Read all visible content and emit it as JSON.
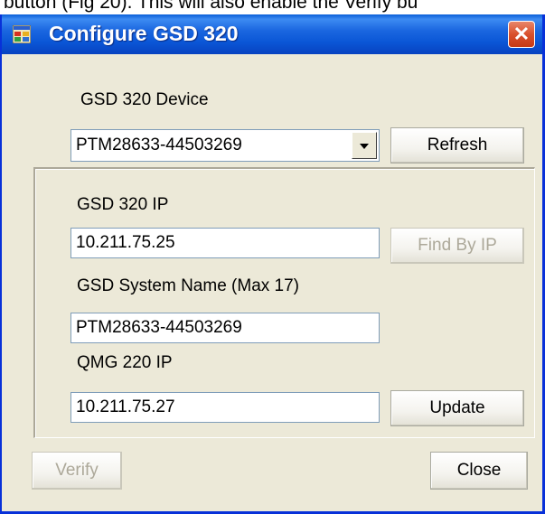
{
  "background_doc": {
    "text": "button (Fig 20). This will also enable the Verify bu"
  },
  "window": {
    "title": "Configure GSD 320",
    "close_glyph": "✕"
  },
  "device": {
    "label": "GSD 320 Device",
    "selected": "PTM28633-44503269",
    "refresh_label": "Refresh"
  },
  "ip": {
    "label": "GSD 320 IP",
    "value": "10.211.75.25",
    "find_label": "Find By IP"
  },
  "system_name": {
    "label": "GSD System Name  (Max 17)",
    "value": "PTM28633-44503269"
  },
  "qmg": {
    "label": "QMG 220 IP",
    "value": "10.211.75.27",
    "update_label": "Update"
  },
  "footer": {
    "verify_label": "Verify",
    "close_label": "Close"
  },
  "colors": {
    "titlebar": "#0a56d6",
    "dialog_bg": "#ece9d8",
    "close_red": "#d9502c",
    "disabled_text": "#aca899"
  },
  "icons": {
    "app": "window-app-icon",
    "close": "close-x-icon",
    "dropdown": "chevron-down-icon"
  }
}
